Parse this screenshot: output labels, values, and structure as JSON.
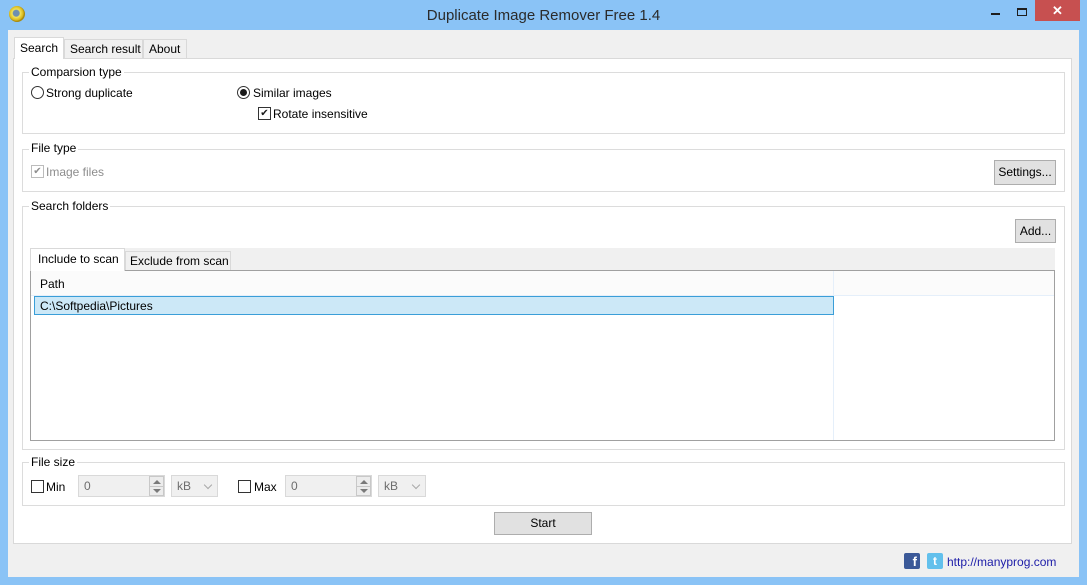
{
  "window": {
    "title": "Duplicate Image Remover Free 1.4",
    "close_glyph": "✕"
  },
  "tabs": [
    {
      "label": "Search",
      "selected": true
    },
    {
      "label": "Search result",
      "selected": false
    },
    {
      "label": "About",
      "selected": false
    }
  ],
  "comparison": {
    "title": "Comparsion type",
    "strong_duplicate": {
      "label": "Strong duplicate",
      "selected": false
    },
    "similar_images": {
      "label": "Similar images",
      "selected": true
    },
    "rotate_insensitive": {
      "label": "Rotate insensitive",
      "checked": true
    }
  },
  "file_type": {
    "title": "File type",
    "image_files": {
      "label": "Image files",
      "checked": true,
      "disabled": true
    },
    "settings_label": "Settings..."
  },
  "search_folders": {
    "title": "Search folders",
    "add_label": "Add...",
    "tabs": [
      {
        "label": "Include to scan",
        "selected": true
      },
      {
        "label": "Exclude from scan",
        "selected": false
      }
    ],
    "columns": [
      "Path"
    ],
    "rows": [
      {
        "path": "C:\\Softpedia\\Pictures",
        "selected": true
      }
    ]
  },
  "file_size": {
    "title": "File size",
    "min": {
      "label": "Min",
      "checked": false,
      "value": "0",
      "unit": "kB"
    },
    "max": {
      "label": "Max",
      "checked": false,
      "value": "0",
      "unit": "kB"
    }
  },
  "start_label": "Start",
  "footer": {
    "facebook_glyph": "f",
    "twitter_glyph": "t",
    "link": "http://manyprog.com"
  },
  "check_glyph": "✔"
}
